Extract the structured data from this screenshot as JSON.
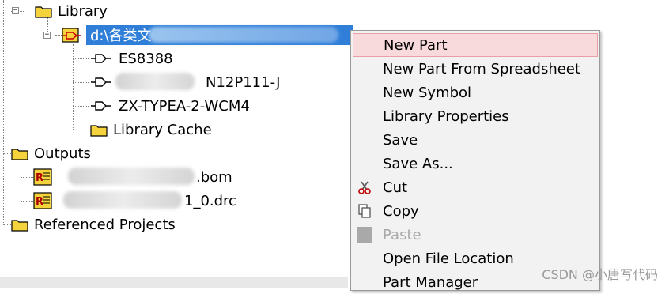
{
  "tree": {
    "library": {
      "label": "Library",
      "expander": "−"
    },
    "library_file": {
      "label": "d:\\各类文",
      "expander": "−"
    },
    "parts": [
      {
        "label": "ES8388"
      },
      {
        "label": "N12P111-J"
      },
      {
        "label": "ZX-TYPEA-2-WCM4"
      }
    ],
    "library_cache": {
      "label": "Library Cache"
    },
    "outputs": {
      "label": "Outputs",
      "expander": "−"
    },
    "output_files": [
      {
        "label": ".bom"
      },
      {
        "label": "1_0.drc"
      }
    ],
    "referenced_projects": {
      "label": "Referenced Projects",
      "expander": "−"
    }
  },
  "context_menu": {
    "items": [
      {
        "label": "New Part",
        "state": "highlighted"
      },
      {
        "label": "New Part From Spreadsheet"
      },
      {
        "label": "New Symbol"
      },
      {
        "label": "Library Properties"
      },
      {
        "label": "Save"
      },
      {
        "label": "Save As..."
      },
      {
        "label": "Cut",
        "icon": "scissors-icon"
      },
      {
        "label": "Copy",
        "icon": "copy-icon"
      },
      {
        "label": "Paste",
        "icon": "paste-icon",
        "state": "disabled"
      },
      {
        "label": "Open File Location"
      },
      {
        "label": "Part Manager"
      }
    ]
  },
  "watermark": "CSDN @小唐写代码",
  "colors": {
    "selection": "#2f7fd8",
    "menu_highlight": "#f8d9dc",
    "folder": "#f5d33c"
  }
}
